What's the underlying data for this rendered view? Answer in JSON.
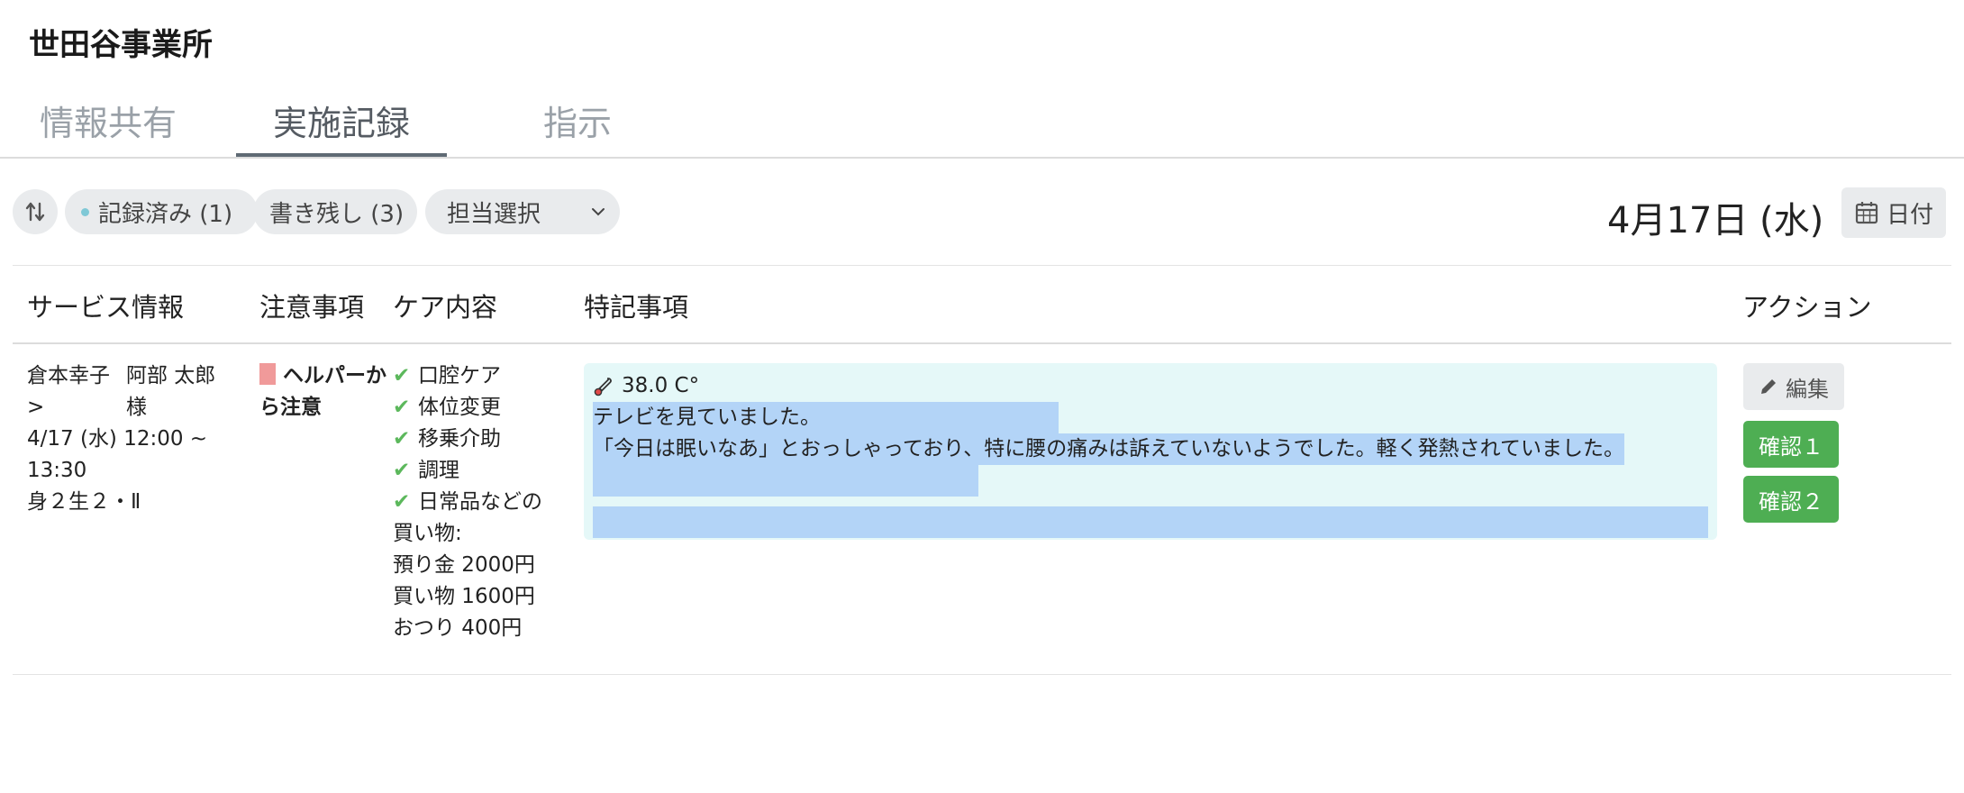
{
  "header": {
    "office_name": "世田谷事業所"
  },
  "tabs": [
    {
      "label": "情報共有",
      "active": false
    },
    {
      "label": "実施記録",
      "active": true
    },
    {
      "label": "指示",
      "active": false
    }
  ],
  "toolbar": {
    "sort_icon": "sort-arrows-icon",
    "filter_recorded": "記録済み (1)",
    "filter_left": "書き残し (3)",
    "staff_select": "担当選択",
    "date_label": "4月17日 (水)",
    "date_button": "日付"
  },
  "table": {
    "headers": [
      "サービス情報",
      "注意事項",
      "ケア内容",
      "特記事項",
      "アクション"
    ],
    "rows": [
      {
        "service": {
          "staff": "倉本幸子 >",
          "user": "阿部 太郎 様",
          "time": "4/17 (水) 12:00 ~ 13:30",
          "classification": "身２生２・Ⅱ"
        },
        "caution": "ヘルパーから注意",
        "care_items": [
          "口腔ケア",
          "体位変更",
          "移乗介助",
          "調理",
          "日常品などの"
        ],
        "care_extra": [
          "買い物:",
          "預り金 2000円",
          "買い物 1600円",
          "おつり 400円"
        ],
        "notes": {
          "temperature": "38.0 C°",
          "line1": "テレビを見ていました。",
          "line2": "「今日は眠いなあ」とおっしゃっており、特に腰の痛みは訴えていないようでした。軽く発熱されていました。"
        },
        "actions": {
          "edit": "編集",
          "confirm1": "確認１",
          "confirm2": "確認２"
        }
      }
    ]
  },
  "colors": {
    "accent_green": "#4eae53",
    "notes_bg": "#e5f8f8",
    "selection": "#b3d4f7",
    "caution_mark": "#f09a9a"
  }
}
